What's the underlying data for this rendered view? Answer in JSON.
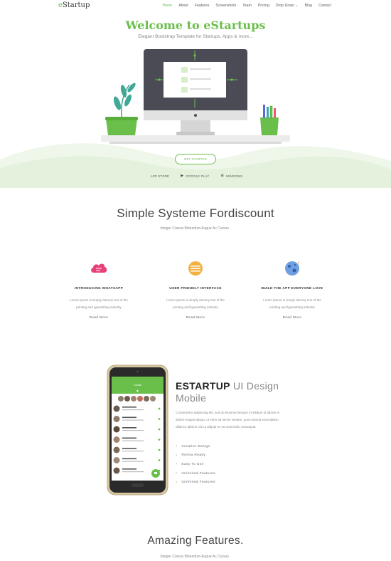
{
  "nav": {
    "logo_initial": "e",
    "logo_rest": "Startup",
    "items": [
      {
        "label": "Home",
        "active": true
      },
      {
        "label": "About"
      },
      {
        "label": "Features"
      },
      {
        "label": "Screenshots"
      },
      {
        "label": "Team"
      },
      {
        "label": "Pricing"
      },
      {
        "label": "Drop Down ⌄"
      },
      {
        "label": "Blog"
      },
      {
        "label": "Contact"
      }
    ]
  },
  "hero": {
    "title": "Welcome to eStartups",
    "subtitle": "Elegant Bootstrap Template for Startups, Apps & more...",
    "cta": "GET STARTED",
    "stores": [
      {
        "icon": "apple-icon",
        "glyph": "",
        "label": "APP STORE"
      },
      {
        "icon": "play-icon",
        "glyph": "▶",
        "label": "GOOGLE PLAY"
      },
      {
        "icon": "windows-icon",
        "glyph": "⊞",
        "label": "WINDOWS"
      }
    ]
  },
  "intro": {
    "title": "Simple Systeme Fordiscount",
    "subtitle": "Integer Cursus Bibendum Augue Ac Cursus ."
  },
  "features": [
    {
      "icon": "cloud-icon",
      "title": "INTRODUCING WHATSAPP",
      "text_1": "Lorem Ipsum is simply dummy text of the",
      "text_2": "printing and typesetting industry",
      "link": "Read More"
    },
    {
      "icon": "ui-icon",
      "title": "USER FRIENDLY INTERFACE",
      "text_1": "Lorem Ipsum is simply dummy text of the",
      "text_2": "printing and typesetting industry",
      "link": "Read More"
    },
    {
      "icon": "planet-icon",
      "title": "BUILD THE APP EVERYONE LOVE",
      "text_1": "Lorem Ipsum is simply dummy text of the",
      "text_2": "printing and typesetting industry",
      "link": "Read More"
    }
  ],
  "design": {
    "title_bold": "ESTARTUP",
    "title_light": " UI Design",
    "title_line2": "Mobile",
    "text": "Consectetur adipiscing elit, sed do eiusmod tempor incididunt ut labore et dolore magna aliqua. ut enim ad minim veniam, quis nostrud exercitation ullamco laboris nisi ut aliquip ex ea commodo consequat",
    "bullet": "›",
    "list": [
      "Creative Design",
      "Retina Ready",
      "Easy To Use",
      "Unlimited Features",
      "Unlimited Features"
    ],
    "phone_header": "Chats"
  },
  "amazing": {
    "title": "Amazing Features.",
    "subtitle": "Integer Cursus Bibendum Augue Ac Cursus ."
  },
  "colors": {
    "accent": "#6abf4b",
    "screen": "#4b4b55"
  }
}
